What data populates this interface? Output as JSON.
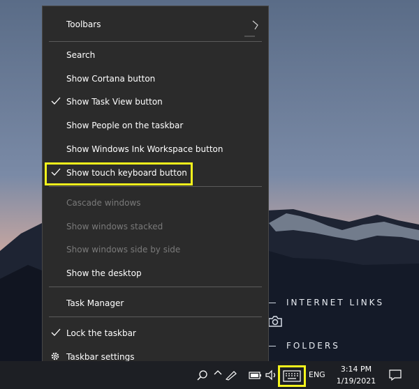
{
  "menu": {
    "items": [
      {
        "label": "Toolbars",
        "checked": false,
        "disabled": false,
        "has_submenu": true
      },
      {
        "label": "Search",
        "checked": false,
        "disabled": false
      },
      {
        "label": "Show Cortana button",
        "checked": false,
        "disabled": false
      },
      {
        "label": "Show Task View button",
        "checked": true,
        "disabled": false
      },
      {
        "label": "Show People on the taskbar",
        "checked": false,
        "disabled": false
      },
      {
        "label": "Show Windows Ink Workspace button",
        "checked": false,
        "disabled": false
      },
      {
        "label": "Show touch keyboard button",
        "checked": true,
        "disabled": false,
        "highlighted": true
      },
      {
        "label": "Cascade windows",
        "checked": false,
        "disabled": true
      },
      {
        "label": "Show windows stacked",
        "checked": false,
        "disabled": true
      },
      {
        "label": "Show windows side by side",
        "checked": false,
        "disabled": true
      },
      {
        "label": "Show the desktop",
        "checked": false,
        "disabled": false
      },
      {
        "label": "Task Manager",
        "checked": false,
        "disabled": false
      },
      {
        "label": "Lock the taskbar",
        "checked": true,
        "disabled": false
      },
      {
        "label": "Taskbar settings",
        "checked": false,
        "disabled": false,
        "icon": "gear-icon"
      }
    ]
  },
  "desktop": {
    "internet_links_label": "INTERNET LINKS",
    "folders_label": "FOLDERS"
  },
  "taskbar": {
    "language": "ENG",
    "time": "3:14 PM",
    "date": "1/19/2021"
  },
  "colors": {
    "highlight": "#f4f41c",
    "menu_background": "#2b2b2b",
    "taskbar_background": "#1d1f24"
  }
}
